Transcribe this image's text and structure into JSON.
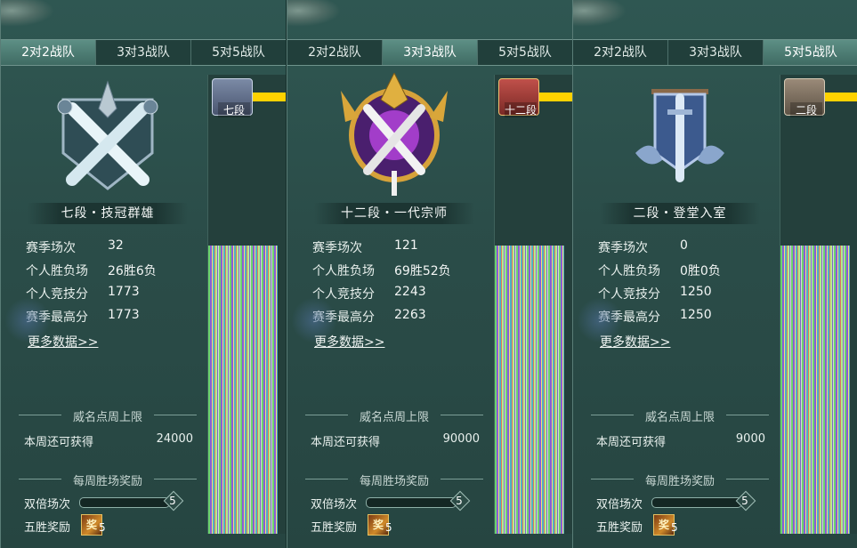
{
  "colors": {
    "panel_bg": "#2b4d49",
    "tab_active": "#5d8f85",
    "yellow": "#ffd200",
    "text": "#e9f1ee"
  },
  "panels": [
    {
      "tabs": [
        {
          "label": "2对2战队",
          "active": true
        },
        {
          "label": "3对3战队",
          "active": false
        },
        {
          "label": "5对5战队",
          "active": false
        }
      ],
      "rank_title": "七段・技冠群雄",
      "stats": [
        {
          "label": "赛季场次",
          "value": "32"
        },
        {
          "label": "个人胜负场",
          "value": "26胜6负"
        },
        {
          "label": "个人竞技分",
          "value": "1773"
        },
        {
          "label": "赛季最高分",
          "value": "1773"
        }
      ],
      "more_link": "更多数据>>",
      "weekly_limit_title": "威名点周上限",
      "weekly_remaining_label": "本周还可获得",
      "weekly_remaining_value": "24000",
      "weekly_reward_title": "每周胜场奖励",
      "double_label": "双倍场次",
      "double_progress": 0.0,
      "double_count": "5",
      "five_win_label": "五胜奖励",
      "five_win_icon": "奖",
      "five_win_count": "5",
      "chest_label": "七段",
      "chest_style": "blue"
    },
    {
      "tabs": [
        {
          "label": "2对2战队",
          "active": false
        },
        {
          "label": "3对3战队",
          "active": true
        },
        {
          "label": "5对5战队",
          "active": false
        }
      ],
      "rank_title": "十二段・一代宗师",
      "stats": [
        {
          "label": "赛季场次",
          "value": "121"
        },
        {
          "label": "个人胜负场",
          "value": "69胜52负"
        },
        {
          "label": "个人竞技分",
          "value": "2243"
        },
        {
          "label": "赛季最高分",
          "value": "2263"
        }
      ],
      "more_link": "更多数据>>",
      "weekly_limit_title": "威名点周上限",
      "weekly_remaining_label": "本周还可获得",
      "weekly_remaining_value": "90000",
      "weekly_reward_title": "每周胜场奖励",
      "double_label": "双倍场次",
      "double_progress": 0.0,
      "double_count": "5",
      "five_win_label": "五胜奖励",
      "five_win_icon": "奖",
      "five_win_count": "5",
      "chest_label": "十二段",
      "chest_style": "red"
    },
    {
      "tabs": [
        {
          "label": "2对2战队",
          "active": false
        },
        {
          "label": "3对3战队",
          "active": false
        },
        {
          "label": "5对5战队",
          "active": true
        }
      ],
      "rank_title": "二段・登堂入室",
      "stats": [
        {
          "label": "赛季场次",
          "value": "0"
        },
        {
          "label": "个人胜负场",
          "value": "0胜0负"
        },
        {
          "label": "个人竞技分",
          "value": "1250"
        },
        {
          "label": "赛季最高分",
          "value": "1250"
        }
      ],
      "more_link": "更多数据>>",
      "weekly_limit_title": "威名点周上限",
      "weekly_remaining_label": "本周还可获得",
      "weekly_remaining_value": "9000",
      "weekly_reward_title": "每周胜场奖励",
      "double_label": "双倍场次",
      "double_progress": 0.0,
      "double_count": "5",
      "five_win_label": "五胜奖励",
      "five_win_icon": "奖",
      "five_win_count": "5",
      "chest_label": "二段",
      "chest_style": "brown"
    }
  ]
}
